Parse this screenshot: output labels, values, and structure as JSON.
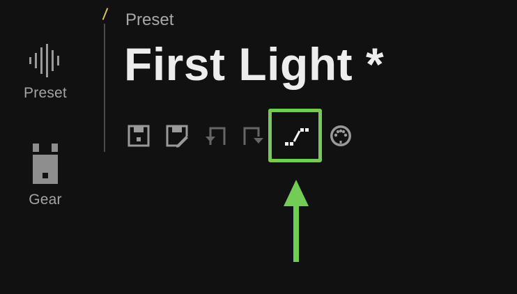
{
  "sidebar": {
    "items": [
      {
        "label": "Preset",
        "icon": "waveform-icon"
      },
      {
        "label": "Gear",
        "icon": "amp-icon"
      }
    ]
  },
  "header": {
    "section_label": "Preset",
    "preset_name": "First Light *"
  },
  "toolbar": {
    "buttons": [
      {
        "icon": "save-icon"
      },
      {
        "icon": "save-as-icon"
      },
      {
        "icon": "undo-icon"
      },
      {
        "icon": "redo-icon"
      },
      {
        "icon": "automation-curve-icon",
        "highlighted": true
      },
      {
        "icon": "midi-icon"
      }
    ]
  },
  "colors": {
    "background": "#111111",
    "title": "#ededed",
    "muted_text": "#a4a4a4",
    "icon": "#9a9a9a",
    "highlight": "#72cc55",
    "accent": "#d9c25a"
  }
}
